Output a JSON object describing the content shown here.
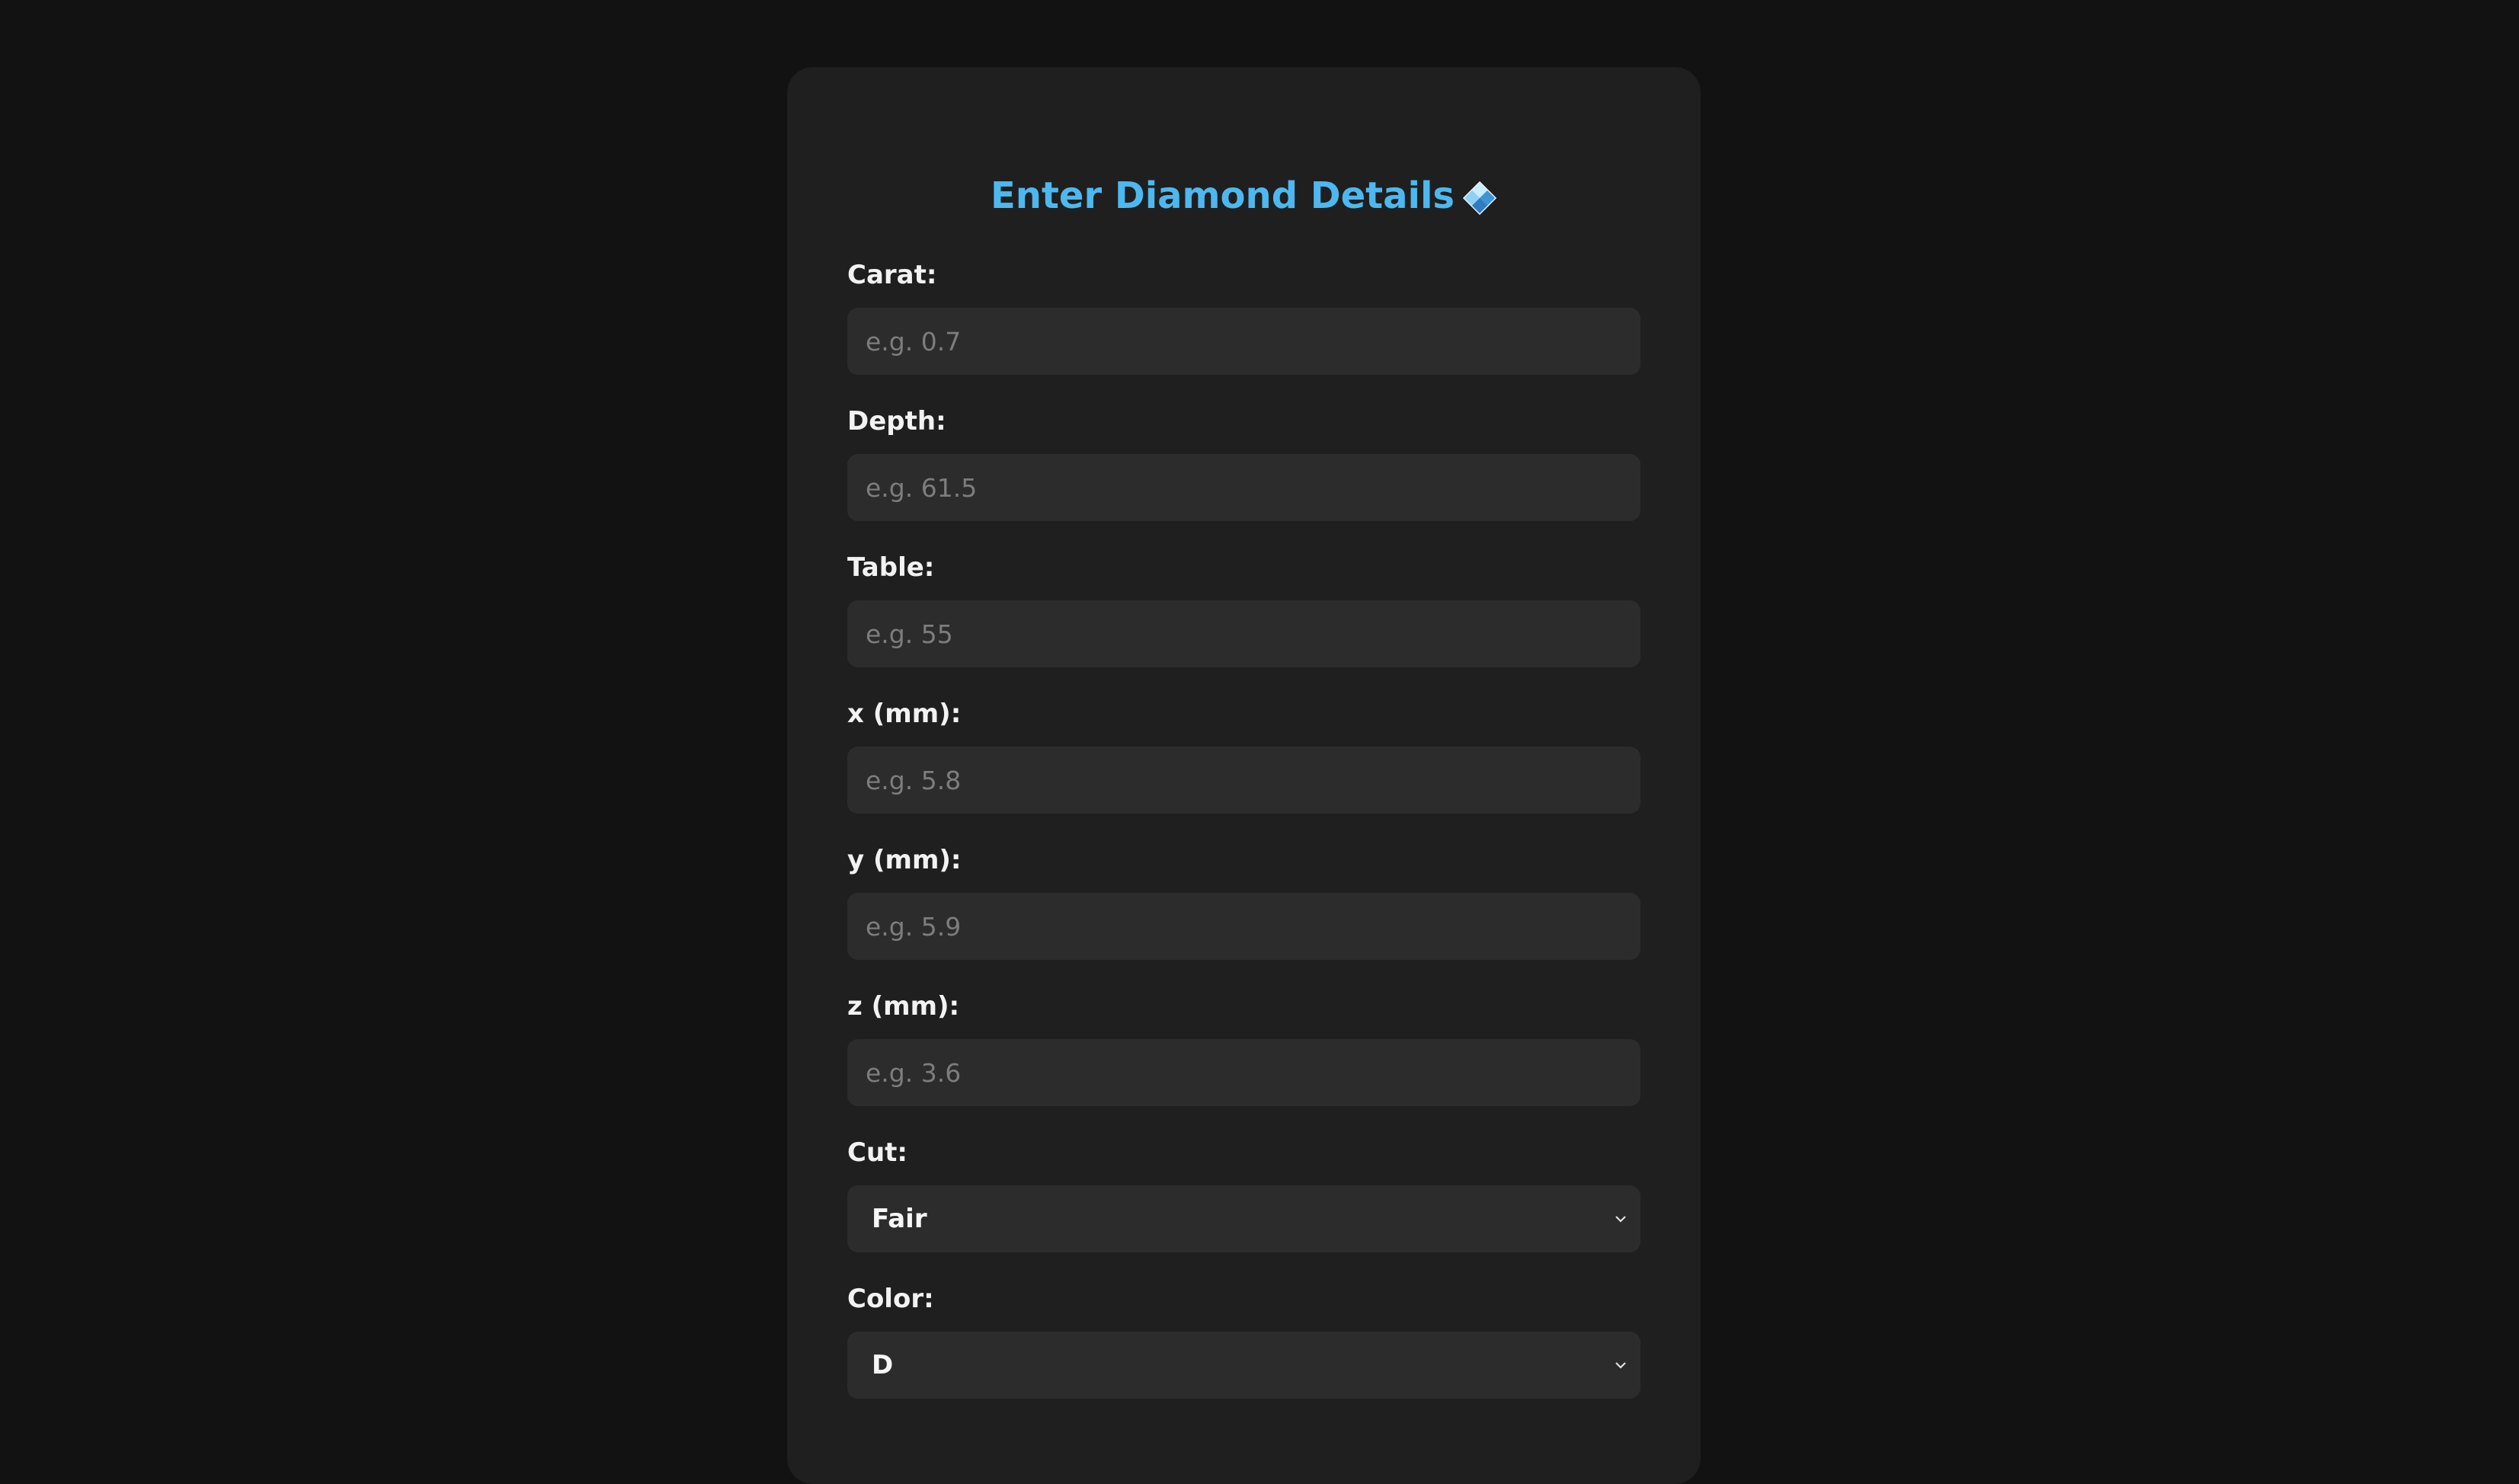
{
  "form": {
    "title": "Enter Diamond Details",
    "title_icon": "diamond-icon",
    "accent_color": "#4db8ef",
    "fields": [
      {
        "label": "Carat:",
        "placeholder": "e.g. 0.7",
        "value": ""
      },
      {
        "label": "Depth:",
        "placeholder": "e.g. 61.5",
        "value": ""
      },
      {
        "label": "Table:",
        "placeholder": "e.g. 55",
        "value": ""
      },
      {
        "label": "x (mm):",
        "placeholder": "e.g. 5.8",
        "value": ""
      },
      {
        "label": "y (mm):",
        "placeholder": "e.g. 5.9",
        "value": ""
      },
      {
        "label": "z (mm):",
        "placeholder": "e.g. 3.6",
        "value": ""
      }
    ],
    "selects": [
      {
        "label": "Cut:",
        "selected": "Fair",
        "icon": "chevron-down-icon"
      },
      {
        "label": "Color:",
        "selected": "D",
        "icon": "chevron-down-icon"
      }
    ]
  }
}
